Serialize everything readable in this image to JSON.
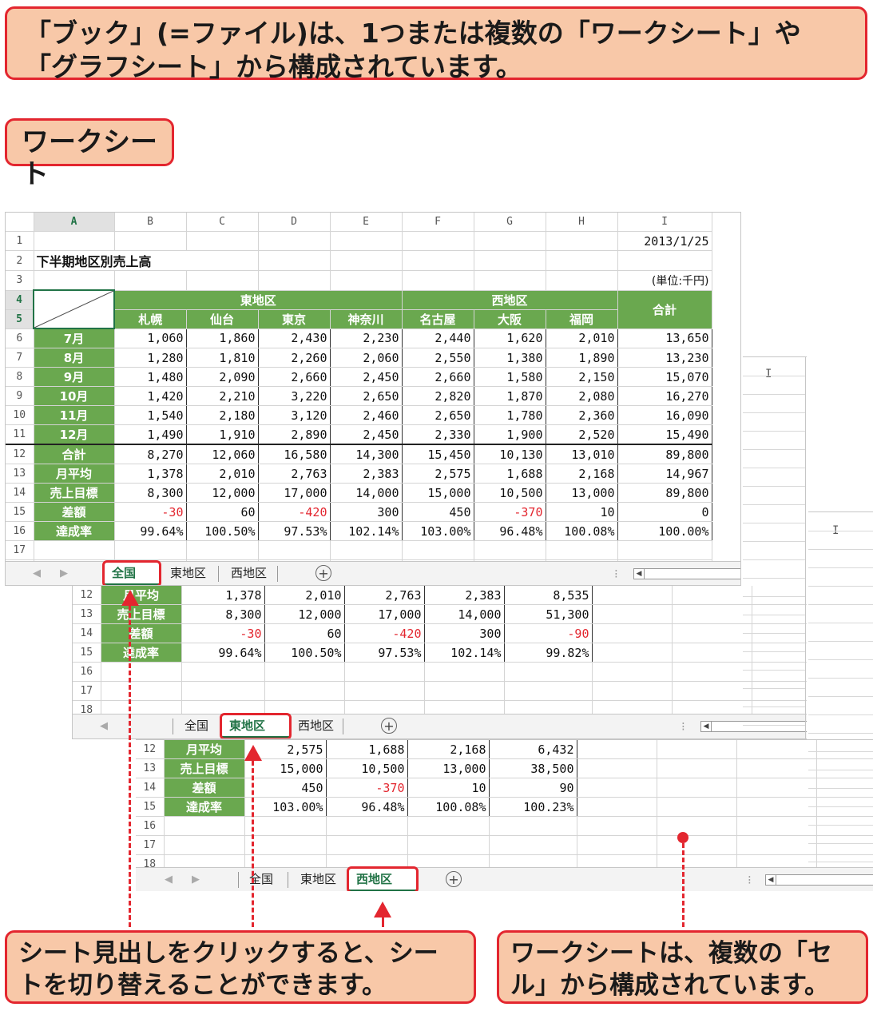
{
  "callouts": {
    "top": "「ブック」(=ファイル)は、1つまたは複数の「ワークシート」や「グラフシート」から構成されています。",
    "worksheet": "ワークシート",
    "tabs_note": "シート見出しをクリックすると、シートを切り替えることができます。",
    "cells_note": "ワークシートは、複数の「セル」から構成されています。"
  },
  "sheet_main": {
    "columns": [
      "A",
      "B",
      "C",
      "D",
      "E",
      "F",
      "G",
      "H",
      "I"
    ],
    "date": "2013/1/25",
    "title": "下半期地区別売上高",
    "unit": "(単位:千円)",
    "east_label": "東地区",
    "west_label": "西地区",
    "total_label": "合計",
    "cities": [
      "札幌",
      "仙台",
      "東京",
      "神奈川",
      "名古屋",
      "大阪",
      "福岡"
    ],
    "rows": [
      {
        "n": "6",
        "label": "7月",
        "values": [
          "1,060",
          "1,860",
          "2,430",
          "2,230",
          "2,440",
          "1,620",
          "2,010",
          "13,650"
        ]
      },
      {
        "n": "7",
        "label": "8月",
        "values": [
          "1,280",
          "1,810",
          "2,260",
          "2,060",
          "2,550",
          "1,380",
          "1,890",
          "13,230"
        ]
      },
      {
        "n": "8",
        "label": "9月",
        "values": [
          "1,480",
          "2,090",
          "2,660",
          "2,450",
          "2,660",
          "1,580",
          "2,150",
          "15,070"
        ]
      },
      {
        "n": "9",
        "label": "10月",
        "values": [
          "1,420",
          "2,210",
          "3,220",
          "2,650",
          "2,820",
          "1,870",
          "2,080",
          "16,270"
        ]
      },
      {
        "n": "10",
        "label": "11月",
        "values": [
          "1,540",
          "2,180",
          "3,120",
          "2,460",
          "2,650",
          "1,780",
          "2,360",
          "16,090"
        ]
      },
      {
        "n": "11",
        "label": "12月",
        "values": [
          "1,490",
          "1,910",
          "2,890",
          "2,450",
          "2,330",
          "1,900",
          "2,520",
          "15,490"
        ]
      },
      {
        "n": "12",
        "label": "合計",
        "values": [
          "8,270",
          "12,060",
          "16,580",
          "14,300",
          "15,450",
          "10,130",
          "13,010",
          "89,800"
        ]
      },
      {
        "n": "13",
        "label": "月平均",
        "values": [
          "1,378",
          "2,010",
          "2,763",
          "2,383",
          "2,575",
          "1,688",
          "2,168",
          "14,967"
        ]
      },
      {
        "n": "14",
        "label": "売上目標",
        "values": [
          "8,300",
          "12,000",
          "17,000",
          "14,000",
          "15,000",
          "10,500",
          "13,000",
          "89,800"
        ]
      },
      {
        "n": "15",
        "label": "差額",
        "values": [
          "-30",
          "60",
          "-420",
          "300",
          "450",
          "-370",
          "10",
          "0"
        ]
      },
      {
        "n": "16",
        "label": "達成率",
        "values": [
          "99.64%",
          "100.50%",
          "97.53%",
          "102.14%",
          "103.00%",
          "96.48%",
          "100.08%",
          "100.00%"
        ]
      }
    ],
    "tabs": [
      "全国",
      "東地区",
      "西地区"
    ]
  },
  "sheet_east": {
    "rows": [
      {
        "n": "12",
        "label": "月平均",
        "values": [
          "1,378",
          "2,010",
          "2,763",
          "2,383",
          "8,535"
        ]
      },
      {
        "n": "13",
        "label": "売上目標",
        "values": [
          "8,300",
          "12,000",
          "17,000",
          "14,000",
          "51,300"
        ]
      },
      {
        "n": "14",
        "label": "差額",
        "values": [
          "-30",
          "60",
          "-420",
          "300",
          "-90"
        ]
      },
      {
        "n": "15",
        "label": "達成率",
        "values": [
          "99.64%",
          "100.50%",
          "97.53%",
          "102.14%",
          "99.82%"
        ]
      }
    ],
    "tabs": [
      "全国",
      "東地区",
      "西地区"
    ]
  },
  "sheet_west": {
    "rows": [
      {
        "n": "12",
        "label": "月平均",
        "values": [
          "2,575",
          "1,688",
          "2,168",
          "6,432"
        ]
      },
      {
        "n": "13",
        "label": "売上目標",
        "values": [
          "15,000",
          "10,500",
          "13,000",
          "38,500"
        ]
      },
      {
        "n": "14",
        "label": "差額",
        "values": [
          "450",
          "-370",
          "10",
          "90"
        ]
      },
      {
        "n": "15",
        "label": "達成率",
        "values": [
          "103.00%",
          "96.48%",
          "100.08%",
          "100.23%"
        ]
      }
    ],
    "tabs": [
      "全国",
      "東地区",
      "西地区"
    ]
  },
  "colors": {
    "accent": "#e3262f",
    "callout_bg": "#f8c8a8",
    "header_green": "#6aa84f",
    "excel_green": "#217346"
  }
}
